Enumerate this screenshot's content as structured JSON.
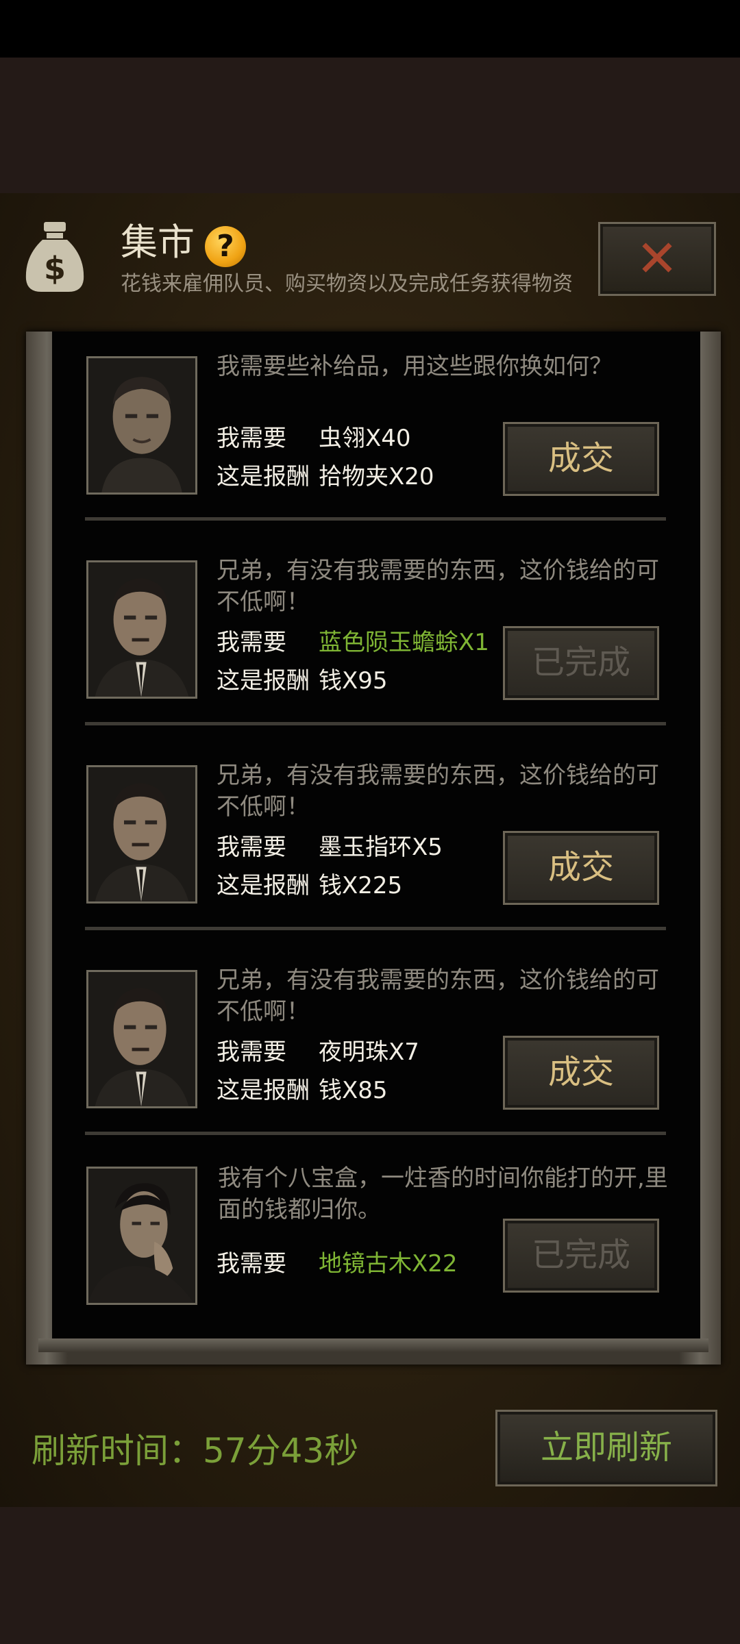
{
  "header": {
    "title": "集市",
    "subtitle": "花钱来雇佣队员、购买物资以及完成任务获得物资",
    "help_icon": "question-icon",
    "bag_icon": "money-bag-icon",
    "close_icon": "close-x-icon"
  },
  "quests": [
    {
      "desc": "我需要些补给品，用这些跟你换如何？",
      "need_label": "我需要",
      "need_value": "虫翎X40",
      "reward_label": "这是报酬",
      "reward_value": "拾物夹X20",
      "button": "成交",
      "completed": false
    },
    {
      "desc": "兄弟，有没有我需要的东西，这价钱给的可不低啊！",
      "need_label": "我需要",
      "need_value": "蓝色陨玉蟾蜍X1",
      "reward_label": "这是报酬",
      "reward_value": "钱X95",
      "button": "已完成",
      "completed": true
    },
    {
      "desc": "兄弟，有没有我需要的东西，这价钱给的可不低啊！",
      "need_label": "我需要",
      "need_value": "墨玉指环X5",
      "reward_label": "这是报酬",
      "reward_value": "钱X225",
      "button": "成交",
      "completed": false
    },
    {
      "desc": "兄弟，有没有我需要的东西，这价钱给的可不低啊！",
      "need_label": "我需要",
      "need_value": "夜明珠X7",
      "reward_label": "这是报酬",
      "reward_value": "钱X85",
      "button": "成交",
      "completed": false
    },
    {
      "desc": "我有个八宝盒，一炷香的时间你能打的开,里面的钱都归你。",
      "need_label": "我需要",
      "need_value": "地镜古木X22",
      "button": "已完成",
      "completed": true
    }
  ],
  "footer": {
    "refresh_time": "刷新时间：57分43秒",
    "refresh_button": "立即刷新"
  },
  "colors": {
    "accent_green": "#7fb534",
    "deal_gold": "#d9bf82",
    "done_gray": "#5f5a52"
  }
}
